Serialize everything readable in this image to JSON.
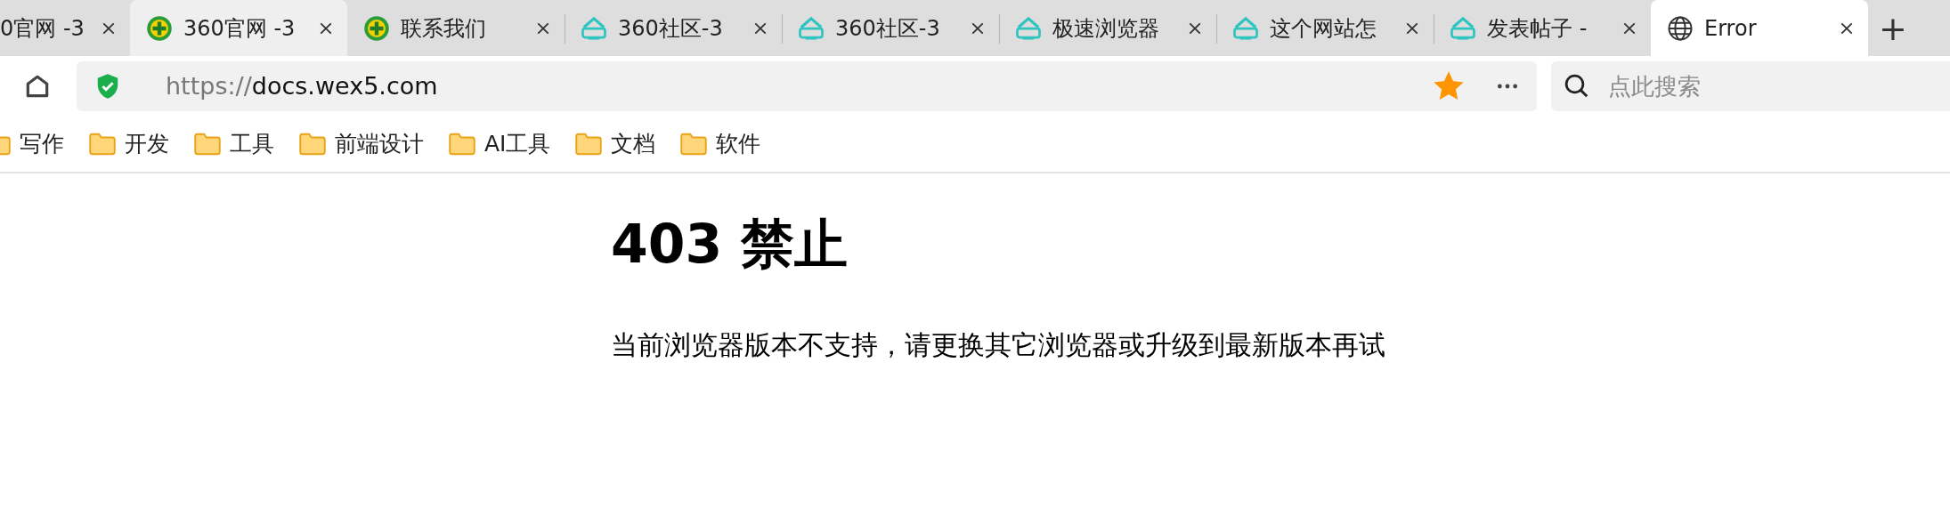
{
  "tabs": [
    {
      "title": "0官网 -3",
      "kind": "none",
      "selected": false,
      "highlighted": false
    },
    {
      "title": "360官网 -3",
      "kind": "plus",
      "selected": false,
      "highlighted": true
    },
    {
      "title": "联系我们",
      "kind": "plus",
      "selected": false,
      "highlighted": false
    },
    {
      "title": "360社区-3",
      "kind": "house",
      "selected": false,
      "highlighted": false
    },
    {
      "title": "360社区-3",
      "kind": "house",
      "selected": false,
      "highlighted": false
    },
    {
      "title": "极速浏览器",
      "kind": "house",
      "selected": false,
      "highlighted": false
    },
    {
      "title": "这个网站怎",
      "kind": "house",
      "selected": false,
      "highlighted": false
    },
    {
      "title": "发表帖子 -",
      "kind": "house",
      "selected": false,
      "highlighted": false
    },
    {
      "title": "Error",
      "kind": "globe",
      "selected": true,
      "highlighted": false
    }
  ],
  "new_tab": "+",
  "address_bar": {
    "scheme": "https://",
    "host": "docs.wex5.com",
    "secure": true,
    "bookmarked": true
  },
  "search": {
    "placeholder": "点此搜索"
  },
  "bookmarks": [
    "写作",
    "开发",
    "工具",
    "前端设计",
    "AI工具",
    "文档",
    "软件"
  ],
  "page": {
    "heading": "403 禁止",
    "message": "当前浏览器版本不支持，请更换其它浏览器或升级到最新版本再试"
  }
}
